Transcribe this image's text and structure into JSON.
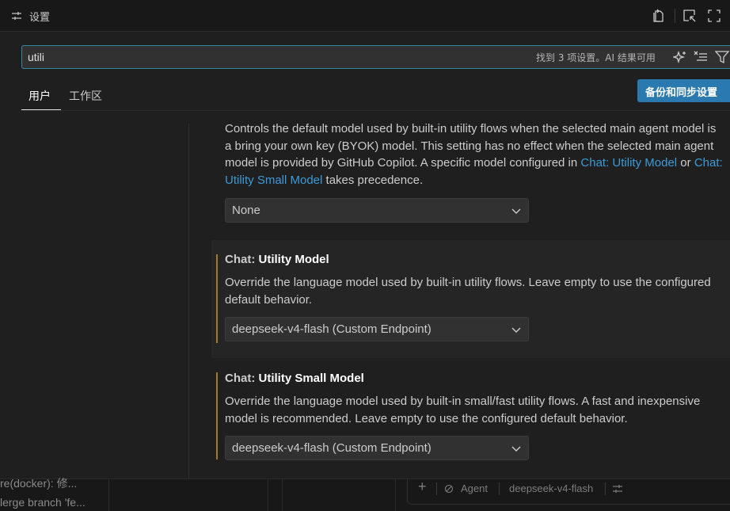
{
  "window": {
    "title": "设置",
    "icons": [
      "settings-sliders-icon",
      "open-json-icon",
      "split-editor-icon",
      "maximize-icon"
    ]
  },
  "search": {
    "value": "utili",
    "result_count": "找到 3 项设置。AI 结果可用",
    "icons": [
      "ai-sparkle-icon",
      "clear-filter-icon",
      "filter-icon"
    ]
  },
  "tabs": [
    {
      "label": "用户",
      "active": true
    },
    {
      "label": "工作区",
      "active": false
    }
  ],
  "sync_button": "备份和同步设置",
  "settings": {
    "default": {
      "desc_1": "Controls the default model used by built-in utility flows when the selected main agent model is a bring your own key (BYOK) model. This setting has no effect when the selected main agent model is provided by GitHub Copilot. A specific model configured in ",
      "link_1": "Chat: Utility Model",
      "desc_2": " or ",
      "link_2": "Chat: Utility Small Model",
      "desc_3": " takes precedence.",
      "value": "None"
    },
    "utility_model": {
      "category": "Chat: ",
      "name": "Utility Model",
      "description": "Override the language model used by built-in utility flows. Leave empty to use the configured default behavior.",
      "value": "deepseek-v4-flash (Custom Endpoint)"
    },
    "utility_small_model": {
      "category": "Chat: ",
      "name": "Utility Small Model",
      "description": "Override the language model used by built-in small/fast utility flows. A fast and inexpensive model is recommended. Leave empty to use the configured default behavior.",
      "value": "deepseek-v4-flash (Custom Endpoint)"
    }
  },
  "bottom": {
    "commits": [
      "re(docker): 修...",
      "lerge branch 'fe..."
    ],
    "chat": {
      "add": "+",
      "mode": "Agent",
      "model": "deepseek-v4-flash"
    }
  },
  "colors": {
    "accent": "#2a7ab0",
    "link": "#3d9ad8",
    "modified_indicator": "#a27a27",
    "focus_border": "#2f8c9e"
  }
}
